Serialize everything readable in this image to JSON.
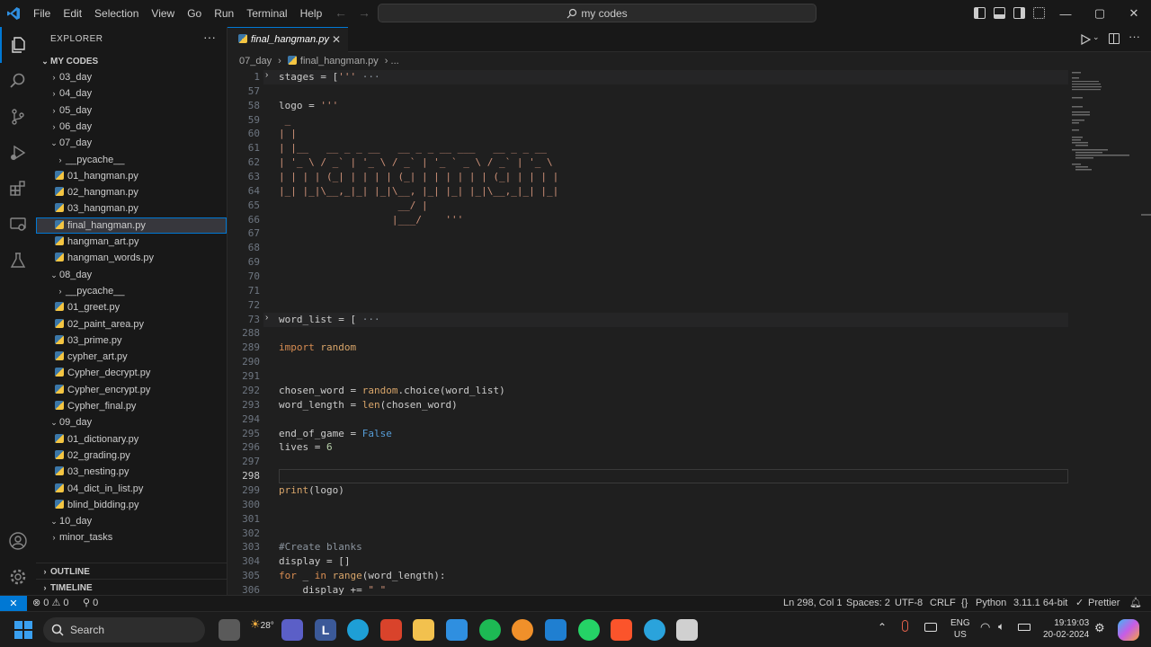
{
  "menu": [
    "File",
    "Edit",
    "Selection",
    "View",
    "Go",
    "Run",
    "Terminal",
    "Help"
  ],
  "command_center": "my codes",
  "window_controls": {
    "minimize": "—",
    "maximize": "▢",
    "close": "✕"
  },
  "sidebar": {
    "title": "EXPLORER",
    "more": "···",
    "root": "MY CODES",
    "tree": [
      {
        "label": "03_day",
        "type": "folder",
        "open": false,
        "depth": 1
      },
      {
        "label": "04_day",
        "type": "folder",
        "open": false,
        "depth": 1
      },
      {
        "label": "05_day",
        "type": "folder",
        "open": false,
        "depth": 1
      },
      {
        "label": "06_day",
        "type": "folder",
        "open": false,
        "depth": 1
      },
      {
        "label": "07_day",
        "type": "folder",
        "open": true,
        "depth": 1
      },
      {
        "label": "__pycache__",
        "type": "folder",
        "open": false,
        "depth": 2
      },
      {
        "label": "01_hangman.py",
        "type": "file",
        "depth": 2
      },
      {
        "label": "02_hangman.py",
        "type": "file",
        "depth": 2
      },
      {
        "label": "03_hangman.py",
        "type": "file",
        "depth": 2
      },
      {
        "label": "final_hangman.py",
        "type": "file",
        "depth": 2,
        "selected": true
      },
      {
        "label": "hangman_art.py",
        "type": "file",
        "depth": 2
      },
      {
        "label": "hangman_words.py",
        "type": "file",
        "depth": 2
      },
      {
        "label": "08_day",
        "type": "folder",
        "open": true,
        "depth": 1
      },
      {
        "label": "__pycache__",
        "type": "folder",
        "open": false,
        "depth": 2
      },
      {
        "label": "01_greet.py",
        "type": "file",
        "depth": 2
      },
      {
        "label": "02_paint_area.py",
        "type": "file",
        "depth": 2
      },
      {
        "label": "03_prime.py",
        "type": "file",
        "depth": 2
      },
      {
        "label": "cypher_art.py",
        "type": "file",
        "depth": 2
      },
      {
        "label": "Cypher_decrypt.py",
        "type": "file",
        "depth": 2
      },
      {
        "label": "Cypher_encrypt.py",
        "type": "file",
        "depth": 2
      },
      {
        "label": "Cypher_final.py",
        "type": "file",
        "depth": 2
      },
      {
        "label": "09_day",
        "type": "folder",
        "open": true,
        "depth": 1
      },
      {
        "label": "01_dictionary.py",
        "type": "file",
        "depth": 2
      },
      {
        "label": "02_grading.py",
        "type": "file",
        "depth": 2
      },
      {
        "label": "03_nesting.py",
        "type": "file",
        "depth": 2
      },
      {
        "label": "04_dict_in_list.py",
        "type": "file",
        "depth": 2
      },
      {
        "label": "blind_bidding.py",
        "type": "file",
        "depth": 2
      },
      {
        "label": "10_day",
        "type": "folder",
        "open": true,
        "depth": 1
      },
      {
        "label": "minor_tasks",
        "type": "folder",
        "open": false,
        "depth": 1
      }
    ],
    "outline": "OUTLINE",
    "timeline": "TIMELINE"
  },
  "tab": {
    "label": "final_hangman.py",
    "close": "✕"
  },
  "breadcrumb": {
    "folder": "07_day",
    "sep": "›",
    "file": "final_hangman.py",
    "more": "› ..."
  },
  "editor": {
    "current_line": "298",
    "lines": [
      {
        "n": "1",
        "fold": true,
        "tokens": [
          [
            "var",
            "stages"
          ],
          [
            "op",
            " = ["
          ],
          [
            "str",
            "'''"
          ],
          [
            "com",
            " ···"
          ]
        ]
      },
      {
        "n": "57",
        "tokens": []
      },
      {
        "n": "58",
        "tokens": [
          [
            "var",
            "logo"
          ],
          [
            "op",
            " = "
          ],
          [
            "str",
            "'''"
          ]
        ]
      },
      {
        "n": "59",
        "tokens": [
          [
            "str",
            " _"
          ]
        ]
      },
      {
        "n": "60",
        "tokens": [
          [
            "str",
            "| |"
          ]
        ]
      },
      {
        "n": "61",
        "tokens": [
          [
            "str",
            "| |__   __ _ _ __   __ _ _ __ ___   __ _ _ __"
          ]
        ]
      },
      {
        "n": "62",
        "tokens": [
          [
            "str",
            "| '_ \\ / _` | '_ \\ / _` | '_ ` _ \\ / _` | '_ \\"
          ]
        ]
      },
      {
        "n": "63",
        "tokens": [
          [
            "str",
            "| | | | (_| | | | | (_| | | | | | | (_| | | | |"
          ]
        ]
      },
      {
        "n": "64",
        "tokens": [
          [
            "str",
            "|_| |_|\\__,_|_| |_|\\__, |_| |_| |_|\\__,_|_| |_|"
          ]
        ]
      },
      {
        "n": "65",
        "tokens": [
          [
            "str",
            "                    __/ |"
          ]
        ]
      },
      {
        "n": "66",
        "tokens": [
          [
            "str",
            "                   |___/    '''"
          ]
        ]
      },
      {
        "n": "67",
        "tokens": []
      },
      {
        "n": "68",
        "tokens": []
      },
      {
        "n": "69",
        "tokens": []
      },
      {
        "n": "70",
        "tokens": []
      },
      {
        "n": "71",
        "tokens": []
      },
      {
        "n": "72",
        "tokens": []
      },
      {
        "n": "73",
        "fold": true,
        "tokens": [
          [
            "var",
            "word_list"
          ],
          [
            "op",
            " = ["
          ],
          [
            "com",
            " ···"
          ]
        ]
      },
      {
        "n": "288",
        "tokens": []
      },
      {
        "n": "289",
        "tokens": [
          [
            "kw",
            "import"
          ],
          [
            "fn",
            " random"
          ]
        ]
      },
      {
        "n": "290",
        "tokens": []
      },
      {
        "n": "291",
        "tokens": []
      },
      {
        "n": "292",
        "tokens": [
          [
            "var",
            "chosen_word"
          ],
          [
            "op",
            " = "
          ],
          [
            "fn",
            "random"
          ],
          [
            "op",
            ".choice(word_list)"
          ]
        ]
      },
      {
        "n": "293",
        "tokens": [
          [
            "var",
            "word_length"
          ],
          [
            "op",
            " = "
          ],
          [
            "fn",
            "len"
          ],
          [
            "op",
            "(chosen_word)"
          ]
        ]
      },
      {
        "n": "294",
        "tokens": []
      },
      {
        "n": "295",
        "tokens": [
          [
            "var",
            "end_of_game"
          ],
          [
            "op",
            " = "
          ],
          [
            "bool",
            "False"
          ]
        ]
      },
      {
        "n": "296",
        "tokens": [
          [
            "var",
            "lives"
          ],
          [
            "op",
            " = "
          ],
          [
            "num",
            "6"
          ]
        ]
      },
      {
        "n": "297",
        "tokens": []
      },
      {
        "n": "298",
        "tokens": []
      },
      {
        "n": "299",
        "tokens": [
          [
            "fn",
            "print"
          ],
          [
            "op",
            "(logo)"
          ]
        ]
      },
      {
        "n": "300",
        "tokens": []
      },
      {
        "n": "301",
        "tokens": []
      },
      {
        "n": "302",
        "tokens": []
      },
      {
        "n": "303",
        "tokens": [
          [
            "com",
            "#Create blanks"
          ]
        ]
      },
      {
        "n": "304",
        "tokens": [
          [
            "var",
            "display"
          ],
          [
            "op",
            " = []"
          ]
        ]
      },
      {
        "n": "305",
        "tokens": [
          [
            "kw",
            "for"
          ],
          [
            "op",
            " _ "
          ],
          [
            "kw",
            "in"
          ],
          [
            "fn",
            " range"
          ],
          [
            "op",
            "(word_length):"
          ]
        ]
      },
      {
        "n": "306",
        "tokens": [
          [
            "op",
            "    display += "
          ],
          [
            "str",
            "\"_\""
          ]
        ]
      }
    ]
  },
  "statusbar": {
    "remote": "✕",
    "problems": "⊗ 0 ⚠ 0",
    "ports": "⚲ 0",
    "position": "Ln 298, Col 1",
    "spaces": "Spaces: 2",
    "encoding": "UTF-8",
    "eol": "CRLF",
    "language": "Python",
    "interpreter": "3.11.1 64-bit",
    "formatter": "Prettier"
  },
  "taskbar": {
    "search": "Search",
    "weather": "28°",
    "lang": "ENG",
    "region": "US",
    "time": "19:19:03",
    "date": "20-02-2024"
  },
  "colors": {
    "accent": "#0078d4",
    "editor_bg": "#1f1f1f",
    "sidebar_bg": "#181818"
  }
}
